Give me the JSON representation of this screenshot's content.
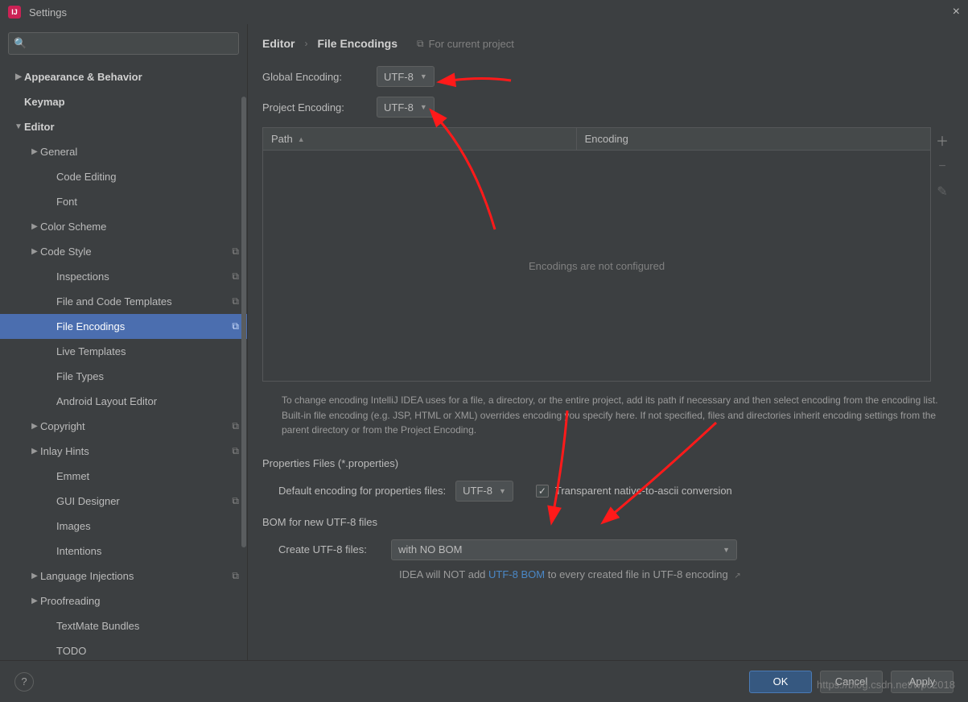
{
  "window": {
    "title": "Settings"
  },
  "search": {
    "placeholder": ""
  },
  "tree": [
    {
      "label": "Appearance & Behavior",
      "arrow": "▶",
      "indent": 0,
      "bold": true
    },
    {
      "label": "Keymap",
      "arrow": "",
      "indent": 0,
      "bold": true
    },
    {
      "label": "Editor",
      "arrow": "▼",
      "indent": 0,
      "bold": true
    },
    {
      "label": "General",
      "arrow": "▶",
      "indent": 1
    },
    {
      "label": "Code Editing",
      "arrow": "",
      "indent": 2
    },
    {
      "label": "Font",
      "arrow": "",
      "indent": 2
    },
    {
      "label": "Color Scheme",
      "arrow": "▶",
      "indent": 1
    },
    {
      "label": "Code Style",
      "arrow": "▶",
      "indent": 1,
      "proj": true
    },
    {
      "label": "Inspections",
      "arrow": "",
      "indent": 2,
      "proj": true
    },
    {
      "label": "File and Code Templates",
      "arrow": "",
      "indent": 2,
      "proj": true
    },
    {
      "label": "File Encodings",
      "arrow": "",
      "indent": 2,
      "selected": true,
      "proj": true
    },
    {
      "label": "Live Templates",
      "arrow": "",
      "indent": 2
    },
    {
      "label": "File Types",
      "arrow": "",
      "indent": 2
    },
    {
      "label": "Android Layout Editor",
      "arrow": "",
      "indent": 2
    },
    {
      "label": "Copyright",
      "arrow": "▶",
      "indent": 1,
      "proj": true
    },
    {
      "label": "Inlay Hints",
      "arrow": "▶",
      "indent": 1,
      "proj": true
    },
    {
      "label": "Emmet",
      "arrow": "",
      "indent": 2
    },
    {
      "label": "GUI Designer",
      "arrow": "",
      "indent": 2,
      "proj": true
    },
    {
      "label": "Images",
      "arrow": "",
      "indent": 2
    },
    {
      "label": "Intentions",
      "arrow": "",
      "indent": 2
    },
    {
      "label": "Language Injections",
      "arrow": "▶",
      "indent": 1,
      "proj": true
    },
    {
      "label": "Proofreading",
      "arrow": "▶",
      "indent": 1
    },
    {
      "label": "TextMate Bundles",
      "arrow": "",
      "indent": 2
    },
    {
      "label": "TODO",
      "arrow": "",
      "indent": 2
    }
  ],
  "breadcrumb": {
    "parent": "Editor",
    "current": "File Encodings",
    "scope": "For current project"
  },
  "global_encoding": {
    "label": "Global Encoding:",
    "value": "UTF-8"
  },
  "project_encoding": {
    "label": "Project Encoding:",
    "value": "UTF-8"
  },
  "table": {
    "col1": "Path",
    "col2": "Encoding",
    "empty": "Encodings are not configured"
  },
  "help_text": "To change encoding IntelliJ IDEA uses for a file, a directory, or the entire project, add its path if necessary and then select encoding from the encoding list. Built-in file encoding (e.g. JSP, HTML or XML) overrides encoding you specify here. If not specified, files and directories inherit encoding settings from the parent directory or from the Project Encoding.",
  "properties": {
    "title": "Properties Files (*.properties)",
    "default_label": "Default encoding for properties files:",
    "default_value": "UTF-8",
    "checkbox_label": "Transparent native-to-ascii conversion",
    "checked": true
  },
  "bom": {
    "title": "BOM for new UTF-8 files",
    "create_label": "Create UTF-8 files:",
    "create_value": "with NO BOM",
    "desc_prefix": "IDEA will NOT add ",
    "desc_link": "UTF-8 BOM",
    "desc_suffix": " to every created file in UTF-8 encoding"
  },
  "buttons": {
    "ok": "OK",
    "cancel": "Cancel",
    "apply": "Apply"
  },
  "watermark": "https://blog.csdn.net/wpc2018"
}
